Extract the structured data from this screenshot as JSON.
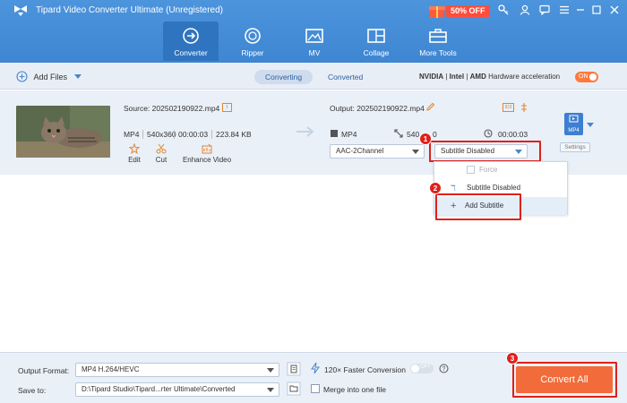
{
  "app": {
    "title": "Tipard Video Converter Ultimate (Unregistered)",
    "promo": "50% OFF"
  },
  "nav": {
    "tabs": [
      {
        "label": "Converter",
        "icon": "converter-icon"
      },
      {
        "label": "Ripper",
        "icon": "ripper-icon"
      },
      {
        "label": "MV",
        "icon": "mv-icon"
      },
      {
        "label": "Collage",
        "icon": "collage-icon"
      },
      {
        "label": "More Tools",
        "icon": "toolbox-icon"
      }
    ],
    "active": "Converter"
  },
  "toolbar": {
    "add_files": "Add Files",
    "seg_converting": "Converting",
    "seg_converted": "Converted",
    "hw_nvidia": "NVIDIA",
    "hw_intel": "Intel",
    "hw_amd": "AMD",
    "hw_label": "Hardware acceleration",
    "hw_toggle": "ON"
  },
  "file": {
    "source": "Source: 202502190922.mp4",
    "format": "MP4",
    "resolution": "540x360",
    "duration": "00:00:03",
    "size": "223.84 KB",
    "edit": "Edit",
    "cut": "Cut",
    "enhance": "Enhance Video",
    "output": "Output: 202502190922.mp4",
    "out_format": "MP4",
    "out_res": "540",
    "out_res_tail": "0",
    "out_duration": "00:00:03",
    "audio": "AAC-2Channel",
    "subtitle": "Subtitle Disabled",
    "format_badge": "MP4",
    "settings": "Settings"
  },
  "submenu": {
    "force": "Force",
    "disabled": "Subtitle Disabled",
    "add": "Add Subtitle"
  },
  "steps": [
    "1",
    "2",
    "3"
  ],
  "bottom": {
    "output_format_label": "Output Format:",
    "output_format": "MP4 H.264/HEVC",
    "save_to_label": "Save to:",
    "save_to": "D:\\Tipard Studio\\Tipard...rter Ultimate\\Converted",
    "faster": "120× Faster Conversion",
    "faster_toggle": "OFF",
    "merge": "Merge into one file",
    "convert_all": "Convert All"
  },
  "colors": {
    "header": "#3f86d2",
    "accent": "#f26b3a",
    "highlight": "#e0201b"
  }
}
